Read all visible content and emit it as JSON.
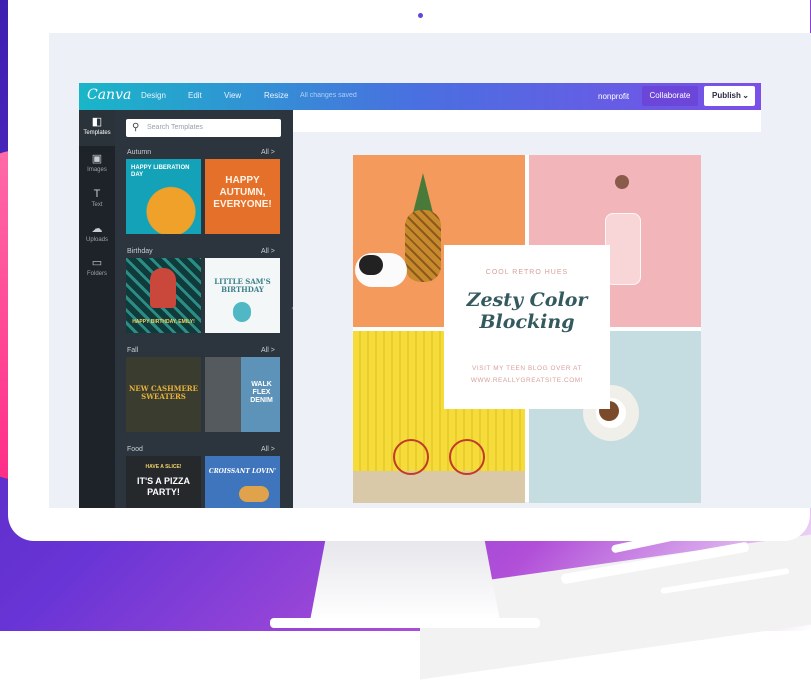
{
  "colors": {
    "accent_gradient_start": "#19b6c8",
    "accent_gradient_end": "#7b4fe8",
    "collaborate_button": "#6c45d9",
    "sidebar": "#1d2328",
    "panel": "#2c353d",
    "card_text": "#34595f",
    "card_accent": "#d7a09a"
  },
  "app": {
    "logo": "Canva",
    "menu": [
      "Design",
      "Edit",
      "View",
      "Resize"
    ],
    "save_status": "All changes saved",
    "account": "nonprofit",
    "collaborate_label": "Collaborate",
    "publish_label": "Publish",
    "publish_icon": "chevron-down-icon"
  },
  "sidebar": {
    "items": [
      {
        "label": "Templates",
        "icon": "templates-icon",
        "glyph": "◧"
      },
      {
        "label": "Images",
        "icon": "image-icon",
        "glyph": "▣"
      },
      {
        "label": "Text",
        "icon": "text-icon",
        "glyph": "T"
      },
      {
        "label": "Uploads",
        "icon": "upload-cloud-icon",
        "glyph": "☁"
      },
      {
        "label": "Folders",
        "icon": "folder-icon",
        "glyph": "▭"
      }
    ]
  },
  "panel": {
    "search_placeholder": "Search Templates",
    "all_label": "All >",
    "sections": [
      {
        "title": "Autumn",
        "thumbs": [
          {
            "text": "HAPPY LIBERATION DAY",
            "kicker": ""
          },
          {
            "text": "HAPPY AUTUMN, EVERYONE!",
            "kicker": ""
          }
        ]
      },
      {
        "title": "Birthday",
        "thumbs": [
          {
            "text": "HAPPY BIRTHDAY, EMILY!",
            "kicker": ""
          },
          {
            "text": "LITTLE SAM'S BIRTHDAY",
            "kicker": ""
          }
        ]
      },
      {
        "title": "Fall",
        "thumbs": [
          {
            "text": "NEW CASHMERE SWEATERS",
            "kicker": ""
          },
          {
            "text": "WALK FLEX DENIM",
            "kicker": ""
          }
        ]
      },
      {
        "title": "Food",
        "thumbs": [
          {
            "text": "IT'S A PIZZA PARTY!",
            "kicker": "HAVE A SLICE!"
          },
          {
            "text": "CROISSANT LOVIN'",
            "kicker": ""
          }
        ]
      }
    ]
  },
  "design": {
    "eyebrow": "COOL RETRO HUES",
    "title_line1": "Zesty Color",
    "title_line2": "Blocking",
    "sub_line1": "VISIT MY TEEN BLOG OVER AT",
    "sub_line2": "WWW.REALLYGREATSITE.COM!"
  }
}
